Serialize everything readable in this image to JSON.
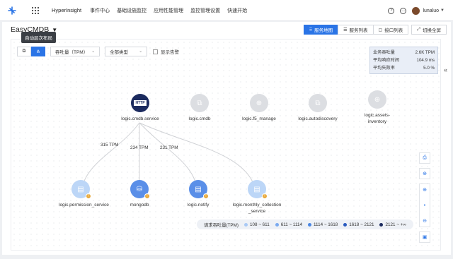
{
  "nav": {
    "brand": "HyperInsight",
    "items": [
      "事件中心",
      "基础设施监控",
      "应用性能管理",
      "监控管理设置",
      "快速开始"
    ]
  },
  "user": {
    "name": "lunaluo",
    "help_icon": "?",
    "message_icon": "…"
  },
  "page": {
    "title": "EasyCMDB",
    "tooltip": "自动层次布局"
  },
  "views": {
    "service_map": "服务地图",
    "service_list": "服务列表",
    "api_list": "接口列表",
    "fullscreen": "切换全屏"
  },
  "toolbar": {
    "metric": "吞吐量（TPM）",
    "type": "全部类型",
    "show_alerts": "显示告警"
  },
  "stats": [
    {
      "label": "业务吞吐量",
      "value": "2.6K TPM"
    },
    {
      "label": "平均响应时间",
      "value": "104.9 ms"
    },
    {
      "label": "平均失败率",
      "value": "5.0 %"
    }
  ],
  "nodes": [
    {
      "name": "logic.cmdb.service",
      "style": "dark",
      "icon": "HTTP"
    },
    {
      "name": "logic.cmdb",
      "style": "gray",
      "icon": "copy"
    },
    {
      "name": "logic.f5_manage",
      "style": "gray",
      "icon": "globe"
    },
    {
      "name": "logic.autodiscovery",
      "style": "gray",
      "icon": "copy"
    },
    {
      "name": "logic.assets-inventory",
      "style": "gray",
      "icon": "globe"
    },
    {
      "name": "logic.permission_service",
      "style": "light",
      "icon": "stack"
    },
    {
      "name": "mongodb",
      "style": "blue",
      "icon": "database"
    },
    {
      "name": "logic.notify",
      "style": "blue",
      "icon": "stack"
    },
    {
      "name": "logic.monthly_collection_service",
      "style": "light",
      "icon": "stack"
    }
  ],
  "edges": [
    {
      "from": "logic.cmdb.service",
      "to": "logic.permission_service",
      "label": "315 TPM"
    },
    {
      "from": "logic.cmdb.service",
      "to": "mongodb",
      "label": "234 TPM"
    },
    {
      "from": "logic.cmdb.service",
      "to": "logic.notify",
      "label": "231 TPM"
    },
    {
      "from": "logic.cmdb.service",
      "to": "logic.monthly_collection_service",
      "label": ""
    }
  ],
  "legend": {
    "title": "请求吞吐量(TPM)",
    "items": [
      {
        "label": "108 ~ 611",
        "color": "#a9c9f5"
      },
      {
        "label": "611 ~ 1114",
        "color": "#7aaaf0"
      },
      {
        "label": "1114 ~ 1618",
        "color": "#4a86e4"
      },
      {
        "label": "1618 ~ 2121",
        "color": "#2a5bbf"
      },
      {
        "label": "2121 ~ +∞",
        "color": "#1b2a5e"
      }
    ]
  }
}
